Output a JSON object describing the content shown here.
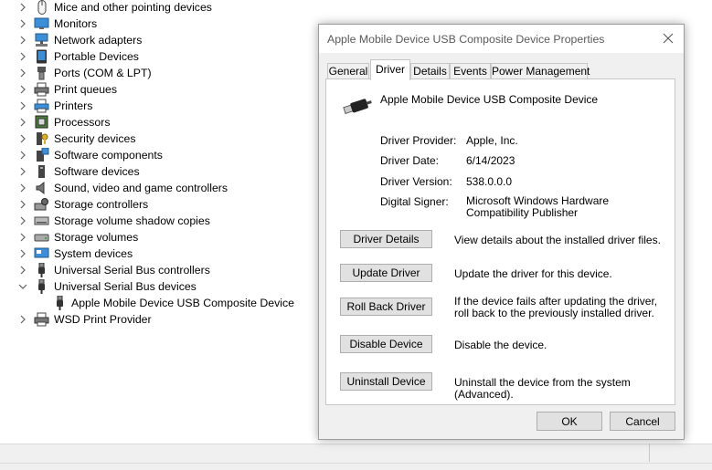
{
  "tree": {
    "items": [
      {
        "label": "Mice and other pointing devices",
        "icon": "mouse-icon",
        "expanded": false
      },
      {
        "label": "Monitors",
        "icon": "monitor-icon",
        "expanded": false
      },
      {
        "label": "Network adapters",
        "icon": "network-adapter-icon",
        "expanded": false
      },
      {
        "label": "Portable Devices",
        "icon": "portable-device-icon",
        "expanded": false
      },
      {
        "label": "Ports (COM & LPT)",
        "icon": "port-icon",
        "expanded": false
      },
      {
        "label": "Print queues",
        "icon": "print-queue-icon",
        "expanded": false
      },
      {
        "label": "Printers",
        "icon": "printer-icon",
        "expanded": false
      },
      {
        "label": "Processors",
        "icon": "processor-icon",
        "expanded": false
      },
      {
        "label": "Security devices",
        "icon": "security-device-icon",
        "expanded": false
      },
      {
        "label": "Software components",
        "icon": "software-component-icon",
        "expanded": false
      },
      {
        "label": "Software devices",
        "icon": "software-device-icon",
        "expanded": false
      },
      {
        "label": "Sound, video and game controllers",
        "icon": "speaker-icon",
        "expanded": false
      },
      {
        "label": "Storage controllers",
        "icon": "storage-controller-icon",
        "expanded": false
      },
      {
        "label": "Storage volume shadow copies",
        "icon": "drive-icon",
        "expanded": false
      },
      {
        "label": "Storage volumes",
        "icon": "drive-icon",
        "expanded": false
      },
      {
        "label": "System devices",
        "icon": "system-device-icon",
        "expanded": false
      },
      {
        "label": "Universal Serial Bus controllers",
        "icon": "usb-icon",
        "expanded": false
      },
      {
        "label": "Universal Serial Bus devices",
        "icon": "usb-icon",
        "expanded": true
      },
      {
        "label": "Apple Mobile Device USB Composite Device",
        "icon": "usb-icon",
        "child": true
      },
      {
        "label": "WSD Print Provider",
        "icon": "printer-icon",
        "expanded": false
      }
    ]
  },
  "dialog": {
    "title": "Apple Mobile Device USB Composite Device Properties",
    "tabs": [
      "General",
      "Driver",
      "Details",
      "Events",
      "Power Management"
    ],
    "active_tab": "Driver",
    "device_name": "Apple Mobile Device USB Composite Device",
    "info": [
      {
        "label": "Driver Provider:",
        "value": "Apple, Inc."
      },
      {
        "label": "Driver Date:",
        "value": "6/14/2023"
      },
      {
        "label": "Driver Version:",
        "value": "538.0.0.0"
      },
      {
        "label": "Digital Signer:",
        "value": "Microsoft Windows Hardware Compatibility Publisher"
      }
    ],
    "actions": [
      {
        "label": "Driver Details",
        "desc": "View details about the installed driver files."
      },
      {
        "label": "Update Driver",
        "desc": "Update the driver for this device."
      },
      {
        "label": "Roll Back Driver",
        "desc": "If the device fails after updating the driver, roll back to the previously installed driver."
      },
      {
        "label": "Disable Device",
        "desc": "Disable the device."
      },
      {
        "label": "Uninstall Device",
        "desc": "Uninstall the device from the system (Advanced)."
      }
    ],
    "ok_label": "OK",
    "cancel_label": "Cancel"
  }
}
